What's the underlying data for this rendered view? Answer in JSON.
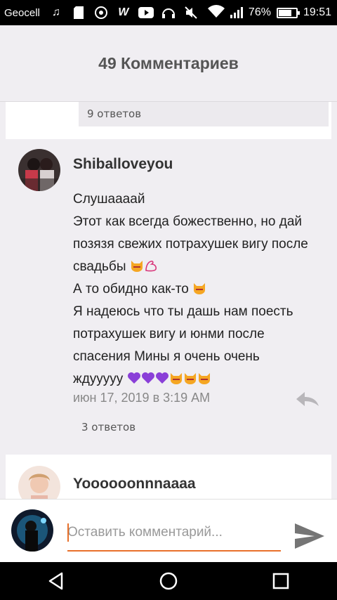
{
  "status_bar": {
    "carrier": "Geocell",
    "battery_percent": "76%",
    "battery_level": 0.76,
    "time": "19:51",
    "icons": [
      "music-icon",
      "sd-card-icon",
      "location-target-icon",
      "w-app-icon",
      "youtube-icon",
      "headset-icon",
      "mute-icon",
      "wifi-icon",
      "signal-icon",
      "battery-icon"
    ]
  },
  "header": {
    "title": "49 Комментариев"
  },
  "previous_comment": {
    "replies_label": "9 ответов"
  },
  "comment": {
    "username": "Shiballoveyou",
    "lines": [
      "Слушаааай",
      "Этот как всегда божественно, но дай",
      "позязя свежих потрахушек вигу после",
      "свадьбы",
      "А то обидно как-то",
      "Я надеюсь что ты дашь нам поесть",
      "потрахушек вигу и юнми после",
      "спасения Мины я очень очень",
      "ждууууу"
    ],
    "timestamp": "июн 17, 2019 в 3:19 AM",
    "replies_label": "3 ответов"
  },
  "next_comment": {
    "username": "Yoooooonnnaaaa"
  },
  "composer": {
    "placeholder": "Оставить комментарий...",
    "value": ""
  },
  "colors": {
    "accent": "#e8702a",
    "heart": "#8a3fd8",
    "emoji_cat": "#f5a623"
  }
}
